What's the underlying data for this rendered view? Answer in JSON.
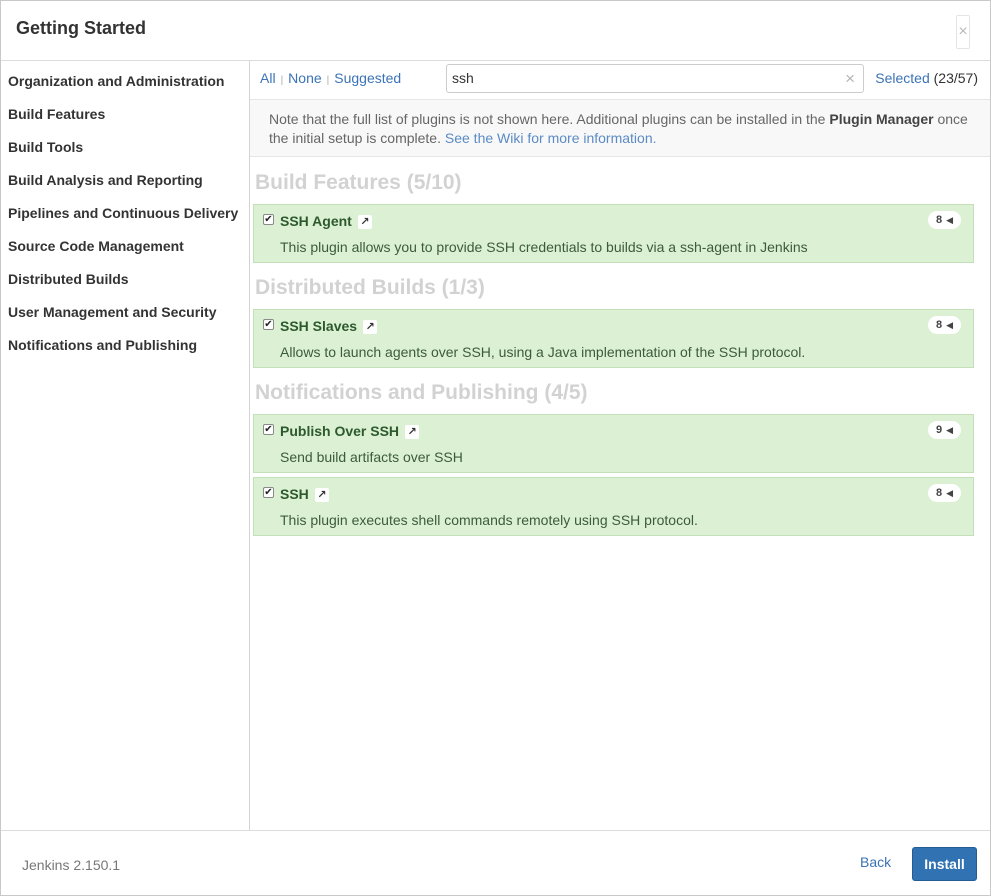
{
  "dialog": {
    "title": "Getting Started",
    "close_label": "×"
  },
  "sidebar": {
    "items": [
      {
        "label": "Organization and Administration"
      },
      {
        "label": "Build Features"
      },
      {
        "label": "Build Tools"
      },
      {
        "label": "Build Analysis and Reporting"
      },
      {
        "label": "Pipelines and Continuous Delivery"
      },
      {
        "label": "Source Code Management"
      },
      {
        "label": "Distributed Builds"
      },
      {
        "label": "User Management and Security"
      },
      {
        "label": "Notifications and Publishing"
      }
    ]
  },
  "toolbar": {
    "all_label": "All",
    "none_label": "None",
    "suggested_label": "Suggested",
    "separator": "|",
    "search_value": "ssh",
    "clear_label": "×",
    "selected_label": "Selected",
    "selected_count": "(23/57)"
  },
  "note": {
    "text_before": "Note that the full list of plugins is not shown here. Additional plugins can be installed in the ",
    "plugin_manager": "Plugin Manager",
    "text_after": " once the initial setup is complete. ",
    "wiki_link": "See the Wiki for more information."
  },
  "categories": [
    {
      "title": "Build Features (5/10)",
      "plugins": [
        {
          "name": "SSH Agent",
          "desc": "This plugin allows you to provide SSH credentials to builds via a ssh-agent in Jenkins",
          "deps": "8",
          "checked": true
        }
      ]
    },
    {
      "title": "Distributed Builds (1/3)",
      "plugins": [
        {
          "name": "SSH Slaves",
          "desc": "Allows to launch agents over SSH, using a Java implementation of the SSH protocol.",
          "deps": "8",
          "checked": true
        }
      ]
    },
    {
      "title": "Notifications and Publishing (4/5)",
      "plugins": [
        {
          "name": "Publish Over SSH",
          "desc": "Send build artifacts over SSH",
          "deps": "9",
          "checked": true
        },
        {
          "name": "SSH",
          "desc": "This plugin executes shell commands remotely using SSH protocol.",
          "deps": "8",
          "checked": true
        }
      ]
    }
  ],
  "icons": {
    "checkbox": "checkmark-icon",
    "external": "external-link-icon",
    "deps_arrow": "caret-left-icon"
  },
  "footer": {
    "version": "Jenkins 2.150.1",
    "back_label": "Back",
    "install_label": "Install"
  },
  "colors": {
    "plugin_bg": "#dcf0d4",
    "link": "#3b73b6",
    "install_bg": "#3072b2"
  }
}
